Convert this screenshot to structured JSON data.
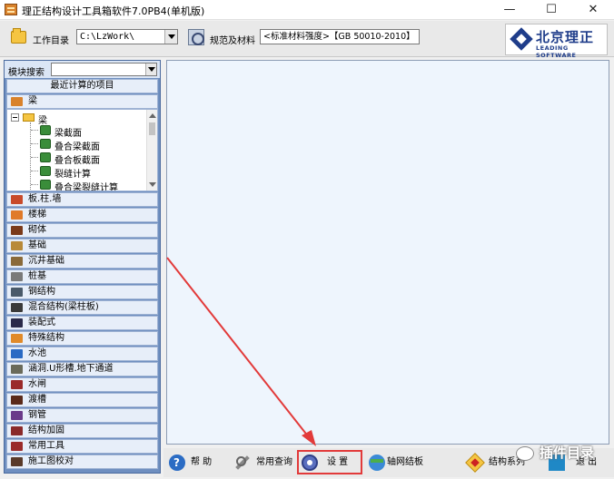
{
  "window": {
    "title": "理正结构设计工具箱软件7.0PB4(单机版)",
    "minimize": "—",
    "maximize": "☐",
    "close": "✕"
  },
  "toolbar": {
    "workdir_label": "工作目录",
    "workdir_value": "C:\\LzWork\\",
    "spec_label": "规范及材料",
    "spec_value": "<标准材料强度>【GB 50010-2010】",
    "logo_cn": "北京理正",
    "logo_en": "LEADING SOFTWARE"
  },
  "left_panel": {
    "search_label": "模块搜索",
    "recent": "最近计算的项目",
    "beam_header": "梁",
    "tree": {
      "root": "梁",
      "items": [
        "梁截面",
        "叠合梁截面",
        "叠合板截面",
        "裂缝计算",
        "叠合梁裂缝计算"
      ]
    },
    "categories": [
      "板.柱.墙",
      "楼梯",
      "砌体",
      "基础",
      "沉井基础",
      "桩基",
      "钢结构",
      "混合结构(梁柱板)",
      "装配式",
      "特殊结构",
      "水池",
      "涵洞.U形槽.地下通道",
      "水闸",
      "渡槽",
      "钢管",
      "结构加固",
      "常用工具",
      "施工图校对"
    ]
  },
  "bottom_bar": {
    "help": "帮 助",
    "query": "常用查询",
    "settings": "设 置",
    "grid_board": "轴网结板",
    "structure_series": "结构系列",
    "exit": "退 出"
  },
  "watermark": "插件目录",
  "colors": {
    "panel_blue": "#6f8fc0",
    "row_bg": "#e7eef9",
    "content_bg": "#eef5fd",
    "highlight_red": "#e23a3a",
    "logo_blue": "#1f3d8a"
  }
}
